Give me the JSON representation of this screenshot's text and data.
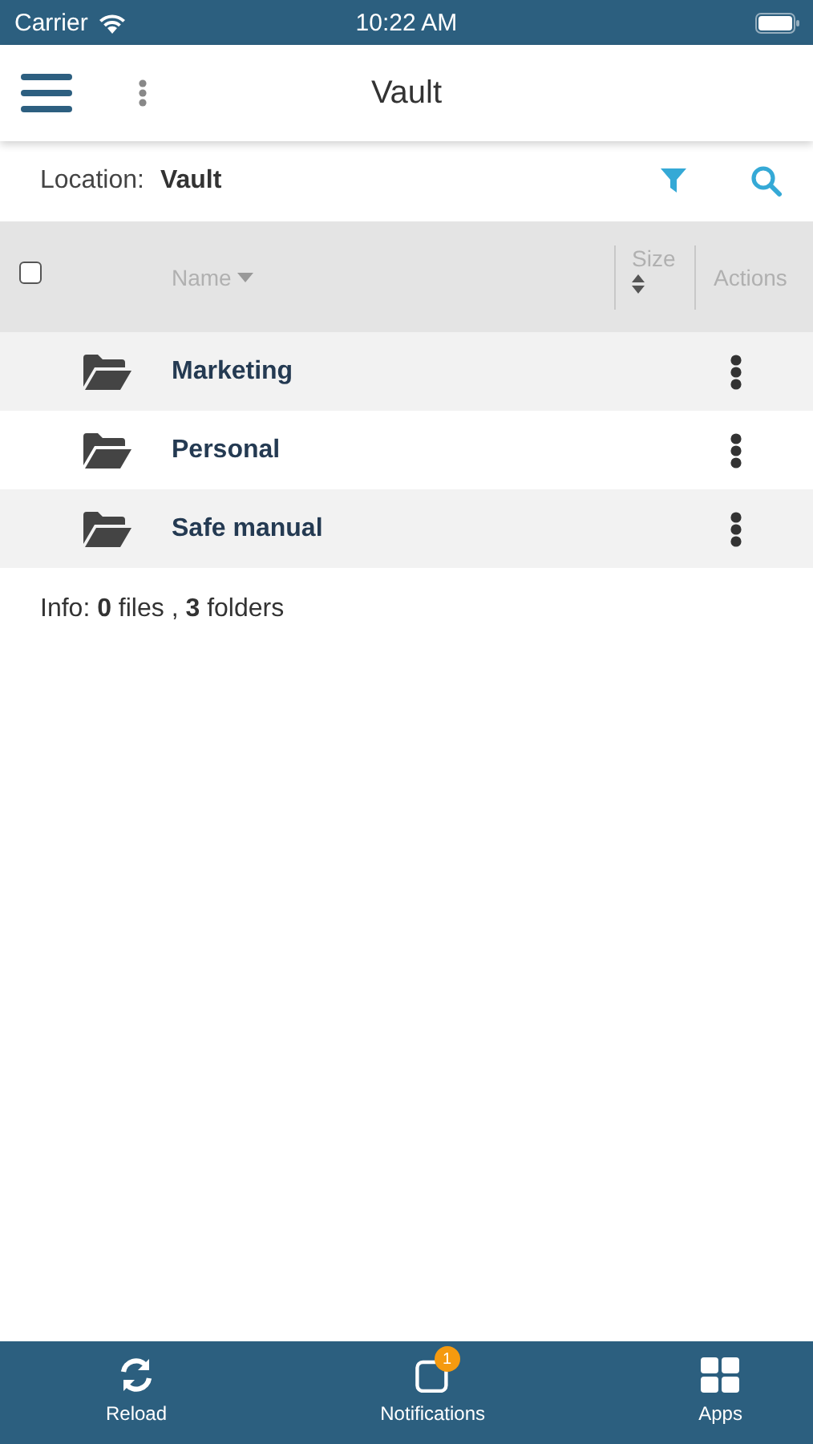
{
  "status_bar": {
    "carrier": "Carrier",
    "time": "10:22 AM"
  },
  "header": {
    "title": "Vault"
  },
  "location": {
    "label": "Location:",
    "value": "Vault"
  },
  "table": {
    "select_all": {
      "checked": false
    },
    "columns": [
      {
        "label": "Name",
        "sorted": true
      },
      {
        "label": "Size",
        "sorted": false
      },
      {
        "label": "Actions"
      }
    ],
    "rows": [
      {
        "name": "Marketing"
      },
      {
        "name": "Personal"
      },
      {
        "name": "Safe manual"
      }
    ]
  },
  "info": "Info: **0** files , **3** folders",
  "tab_bar": [
    {
      "kind": "reload",
      "label": "Reload"
    },
    {
      "kind": "notifications",
      "label": "Notifications",
      "badge": "1"
    },
    {
      "kind": "apps",
      "label": "Apps"
    }
  ]
}
